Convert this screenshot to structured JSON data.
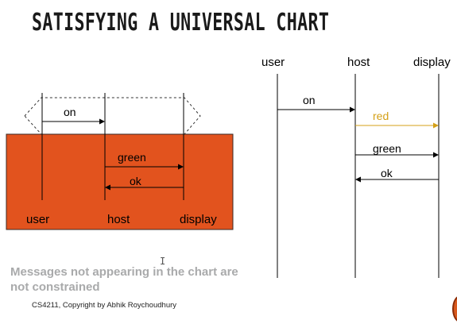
{
  "slide": {
    "title": "SATISFYING A UNIVERSAL CHART",
    "note": "Messages not appearing in the chart are not constrained",
    "footer": "CS4211, Copyright by Abhik Roychoudhury",
    "cursor_glyph": "I"
  },
  "left_chart": {
    "box_color": "#e2531e",
    "lifelines": [
      "user",
      "host",
      "display"
    ],
    "prechart_message": "on",
    "messages": [
      "green",
      "ok"
    ]
  },
  "right_chart": {
    "lifelines": [
      "user",
      "host",
      "display"
    ],
    "messages": [
      {
        "label": "on",
        "color": "#000000"
      },
      {
        "label": "red",
        "color": "#d4a017"
      },
      {
        "label": "green",
        "color": "#000000"
      },
      {
        "label": "ok",
        "color": "#000000"
      }
    ]
  }
}
